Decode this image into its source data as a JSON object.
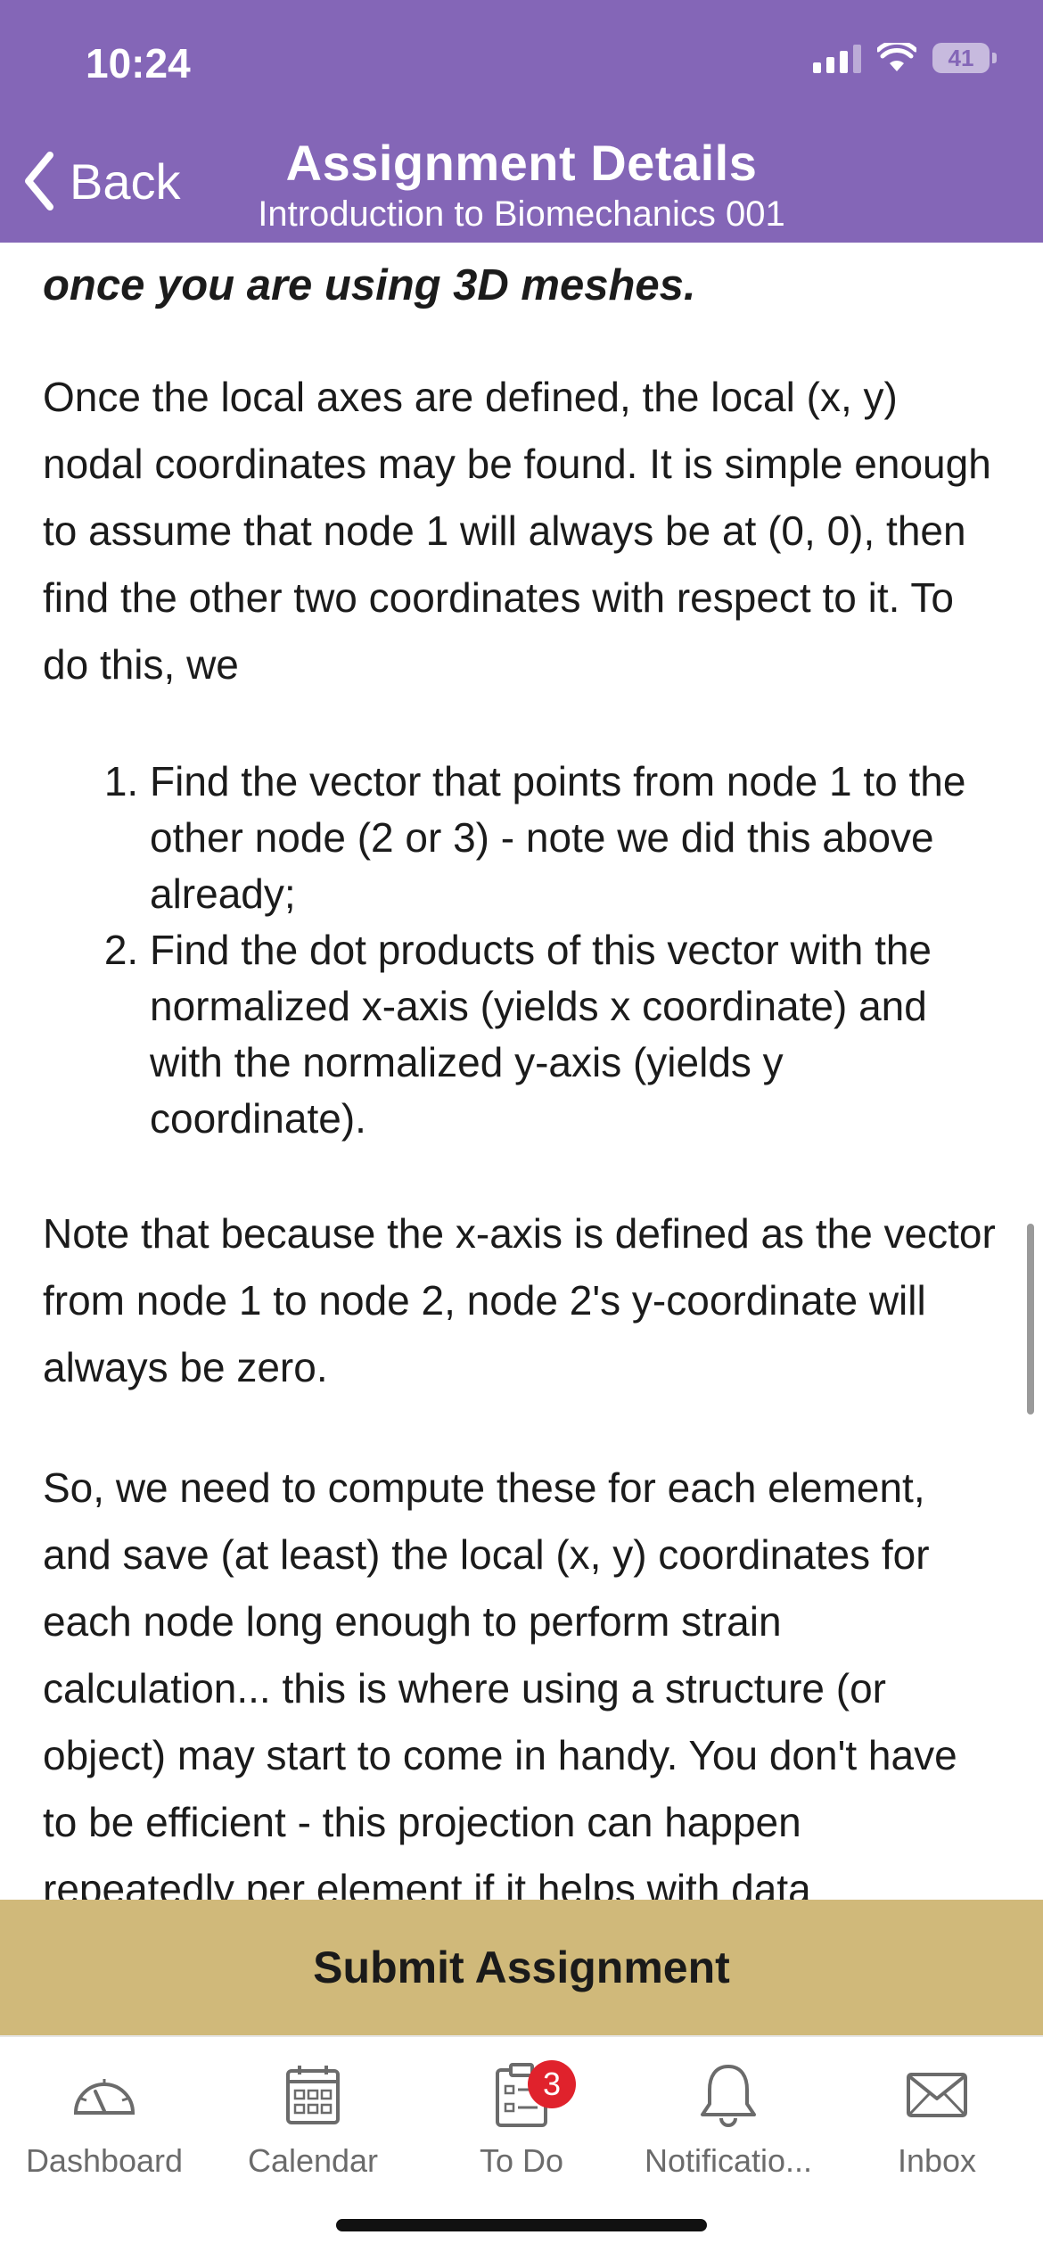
{
  "status_bar": {
    "time": "10:24",
    "battery": "41"
  },
  "header": {
    "back_label": "Back",
    "title": "Assignment Details",
    "subtitle": "Introduction to Biomechanics 001"
  },
  "content": {
    "lead": "once you are using 3D meshes.",
    "para1": "Once the local axes are defined, the local (x, y) nodal coordinates may be found. It is simple enough to assume that node 1 will always be at (0, 0), then find the other two coordinates with respect to it. To do this, we",
    "steps": [
      "Find the vector that points from node 1 to the other node (2 or 3) - note we did this above already;",
      "Find the dot products of this vector with the normalized x-axis (yields x coordinate) and with the normalized y-axis (yields y coordinate)."
    ],
    "para2": "Note that because the x-axis is defined as the vector from node 1 to node 2, node 2's y-coordinate will always be zero.",
    "para3": "So, we need to compute these for each element, and save (at least) the local (x, y) coordinates for each node long enough to perform strain calculation... this is where using a structure (or object) may start to come in handy. You don't have to be efficient - this projection can happen repeatedly per element if it helps with data"
  },
  "submit_label": "Submit Assignment",
  "tabs": [
    {
      "label": "Dashboard",
      "icon": "dashboard-icon"
    },
    {
      "label": "Calendar",
      "icon": "calendar-icon"
    },
    {
      "label": "To Do",
      "icon": "todo-icon",
      "badge": "3"
    },
    {
      "label": "Notificatio...",
      "icon": "bell-icon"
    },
    {
      "label": "Inbox",
      "icon": "inbox-icon"
    }
  ],
  "colors": {
    "header": "#8466b7",
    "submit": "#d0b97a",
    "badge": "#e0222c"
  }
}
